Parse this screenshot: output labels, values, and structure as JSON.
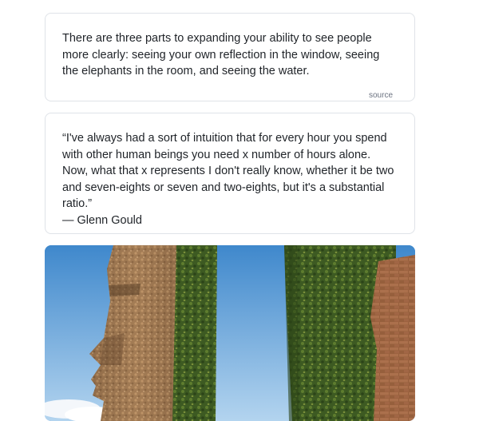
{
  "cards": [
    {
      "text": "There are three parts to expanding your ability to see people more clearly: seeing your own reflection in the window, seeing the elephants in the room, and seeing the water.",
      "source_label": "source"
    },
    {
      "quote": "“I've always had a sort of intuition that for every hour you spend with other human beings you need x number of hours alone. Now, what that x represents I don't really know, whether it be two and seven-eights or seven and two-eights, but it's a substantial ratio.”",
      "attribution": "— Glenn Gould"
    }
  ],
  "image": {
    "icon": "moai-stone-head-landscape-image",
    "colors": {
      "sky_top": "#4a8fd0",
      "sky_bottom": "#a8cdee",
      "stone": "#a07a55",
      "moss": "#3f5a22"
    }
  }
}
